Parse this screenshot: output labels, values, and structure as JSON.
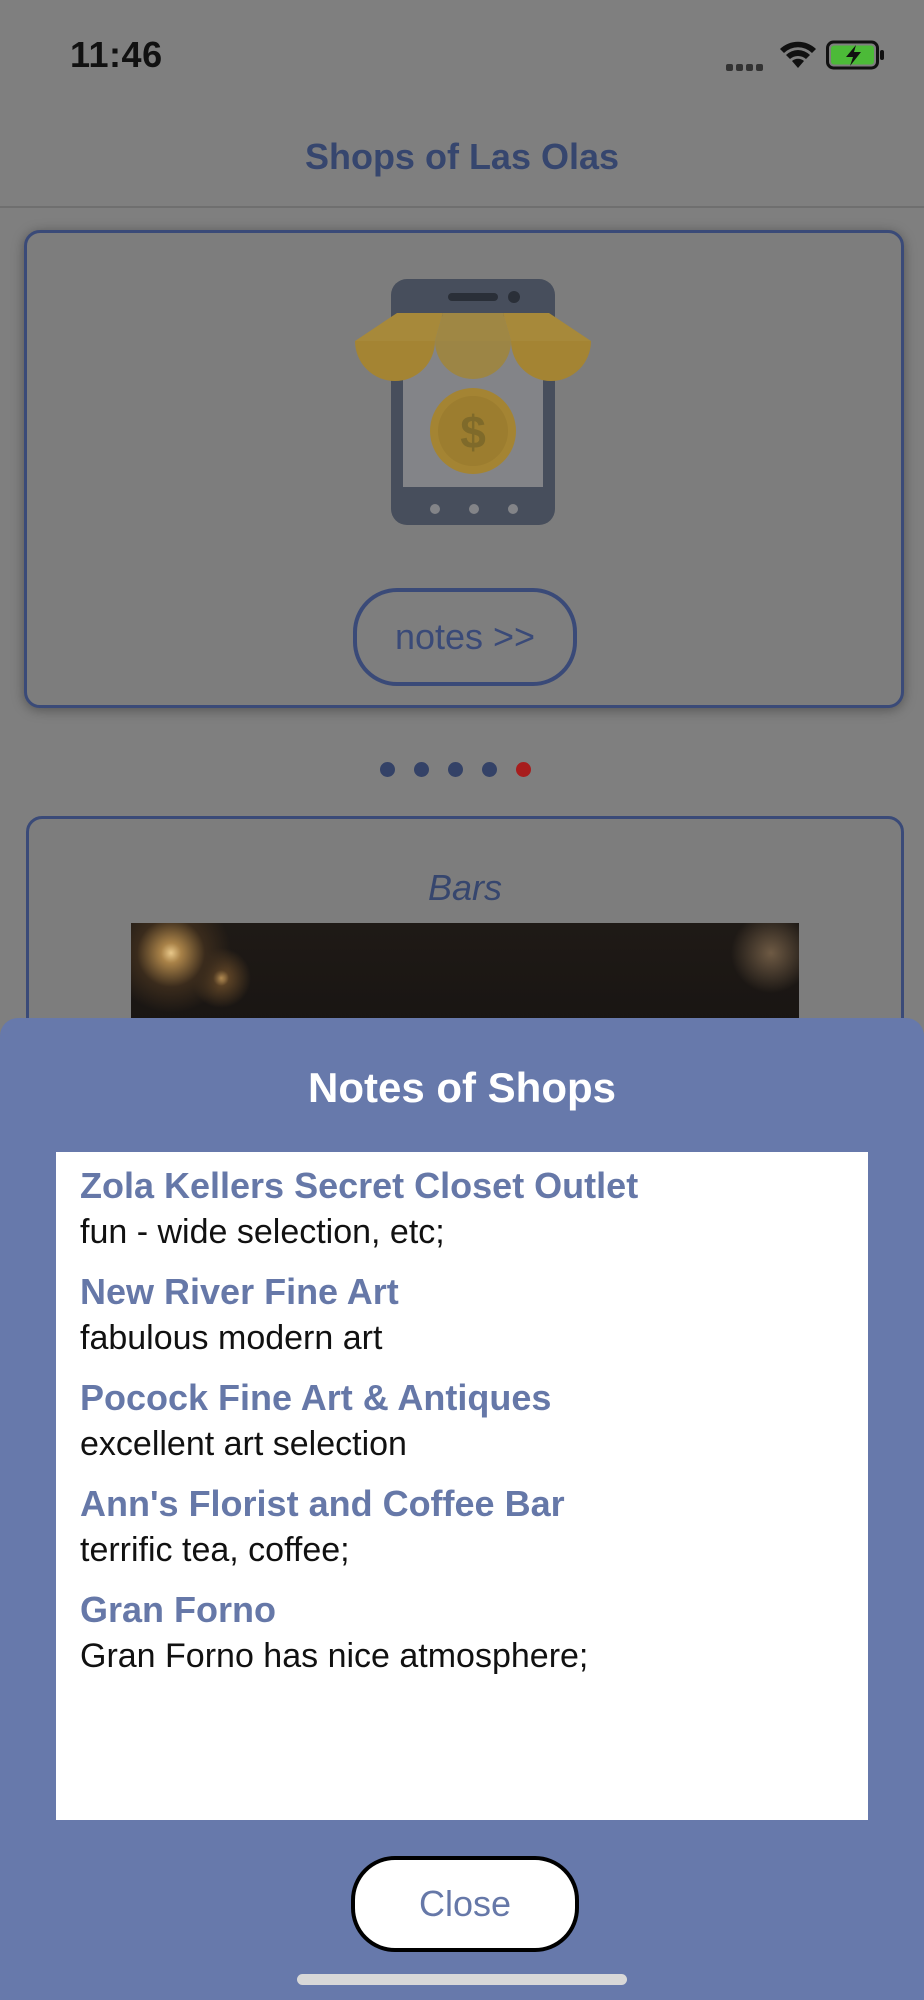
{
  "status_bar": {
    "time": "11:46"
  },
  "navbar": {
    "title": "Shops of Las Olas"
  },
  "carousel": {
    "notes_button_label": "notes >>",
    "page_count": 5,
    "active_page": 5
  },
  "category_card": {
    "title": "Bars"
  },
  "notes_sheet": {
    "title": "Notes of Shops",
    "notes": [
      {
        "name": "Zola Kellers Secret Closet Outlet",
        "text": "fun - wide selection, etc;"
      },
      {
        "name": "New River Fine Art",
        "text": "fabulous modern art"
      },
      {
        "name": "Pocock Fine Art & Antiques",
        "text": "excellent art selection"
      },
      {
        "name": "Ann's Florist and Coffee Bar",
        "text": "terrific tea, coffee;"
      },
      {
        "name": "Gran Forno",
        "text": "Gran Forno has nice atmosphere;"
      }
    ],
    "close_label": "Close"
  },
  "colors": {
    "sheet_background": "#6779ab",
    "note_name": "#6678a8",
    "active_dot": "#a71d1d"
  }
}
